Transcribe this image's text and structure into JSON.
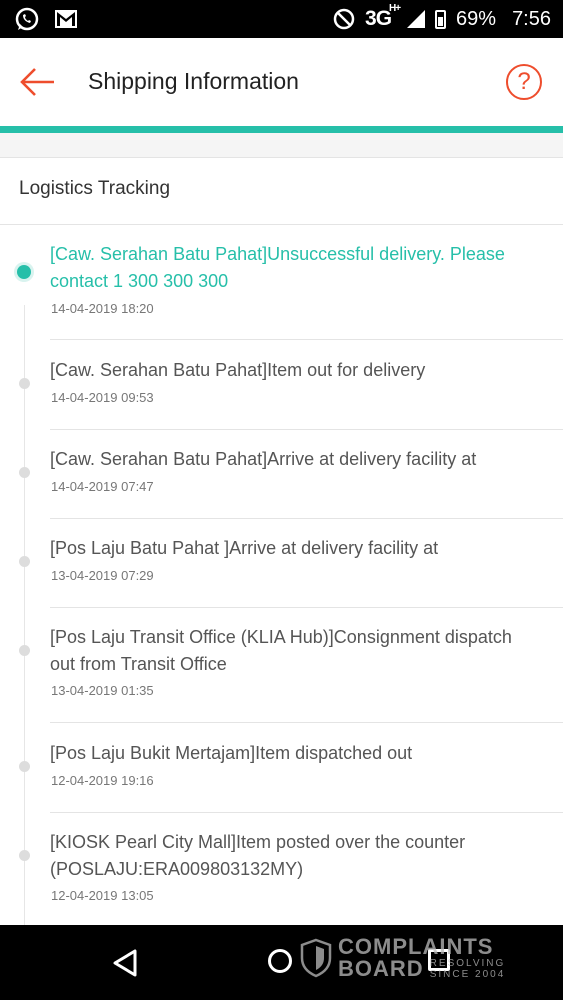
{
  "status_bar": {
    "network": "3G",
    "network_sup": "H+",
    "battery": "69%",
    "time": "7:56",
    "icons": [
      "whatsapp-icon",
      "gmail-icon",
      "do-not-disturb-icon",
      "signal-icon",
      "battery-icon"
    ]
  },
  "app_bar": {
    "title": "Shipping Information",
    "back_icon": "arrow-left-icon",
    "help_label": "?"
  },
  "colors": {
    "accent": "#ee4d2d",
    "teal": "#26bfa9"
  },
  "section": {
    "title": "Logistics Tracking"
  },
  "tracking": [
    {
      "text": "[Caw. Serahan Batu Pahat]Unsuccessful delivery. Please contact 1 300 300 300",
      "time": "14-04-2019 18:20",
      "active": true
    },
    {
      "text": "[Caw. Serahan Batu Pahat]Item out for delivery",
      "time": "14-04-2019 09:53",
      "active": false
    },
    {
      "text": "[Caw. Serahan Batu Pahat]Arrive at delivery facility at",
      "time": "14-04-2019 07:47",
      "active": false
    },
    {
      "text": "[Pos Laju Batu Pahat ]Arrive at delivery facility at",
      "time": "13-04-2019 07:29",
      "active": false
    },
    {
      "text": "[Pos Laju Transit Office (KLIA Hub)]Consignment dispatch out from Transit Office",
      "time": "13-04-2019 01:35",
      "active": false
    },
    {
      "text": "[Pos Laju Bukit Mertajam]Item dispatched out",
      "time": "12-04-2019 19:16",
      "active": false
    },
    {
      "text": "[KIOSK Pearl City Mall]Item posted over the counter (POSLAJU:ERA009803132MY)",
      "time": "12-04-2019 13:05",
      "active": false
    }
  ],
  "watermark": {
    "line1": "COMPLAINTS",
    "line2": "BOARD",
    "line3": "RESOLVING",
    "line4": "SINCE 2004"
  }
}
